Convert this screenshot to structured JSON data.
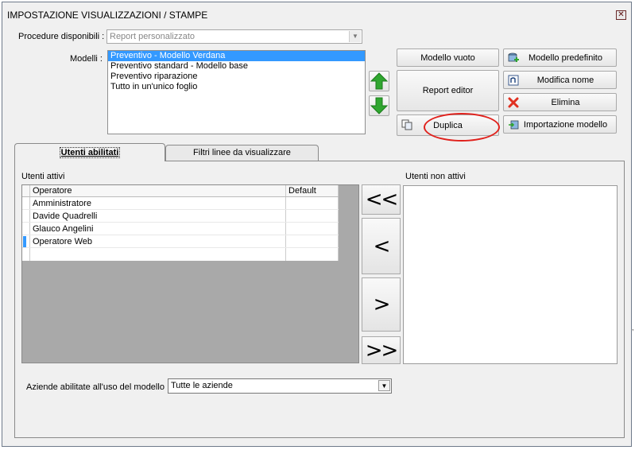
{
  "window": {
    "title": "IMPOSTAZIONE VISUALIZZAZIONI / STAMPE",
    "close_glyph": "✕"
  },
  "procedure": {
    "label": "Procedure disponibili :",
    "value": "Report personalizzato",
    "arrow": "▼"
  },
  "modelli": {
    "label": "Modelli :",
    "items": [
      {
        "label": "Preventivo - Modello Verdana",
        "selected": true
      },
      {
        "label": "Preventivo standard - Modello base",
        "selected": false
      },
      {
        "label": "Preventivo riparazione",
        "selected": false
      },
      {
        "label": "Tutto in un'unico foglio",
        "selected": false
      }
    ]
  },
  "buttons": {
    "modello_vuoto": "Modello vuoto",
    "modello_predefinito": "Modello predefinito",
    "report_editor": "Report editor",
    "modifica_nome": "Modifica nome",
    "elimina": "Elimina",
    "duplica": "Duplica",
    "importazione_modello": "Importazione modello"
  },
  "tabs": [
    {
      "label": "Utenti abilitati",
      "active": true
    },
    {
      "label": "Filtri linee da visualizzare",
      "active": false
    }
  ],
  "utenti_attivi": {
    "label": "Utenti attivi",
    "columns": [
      "Operatore",
      "Default"
    ],
    "rows": [
      {
        "operatore": "Amministratore",
        "default": ""
      },
      {
        "operatore": "Davide Quadrelli",
        "default": ""
      },
      {
        "operatore": "Glauco Angelini",
        "default": ""
      },
      {
        "operatore": "Operatore Web",
        "default": ""
      }
    ]
  },
  "utenti_non_attivi": {
    "label": "Utenti non attivi"
  },
  "move_buttons": {
    "all_left": "<<",
    "left": "<",
    "right": ">",
    "all_right": ">>"
  },
  "aziende": {
    "label": "Aziende abilitate all'uso del modello :",
    "value": "Tutte le aziende",
    "arrow": "▼"
  },
  "colors": {
    "selection": "#3399ff",
    "highlight_annotation": "#e0211c",
    "arrow_green": "#2fa62f"
  }
}
